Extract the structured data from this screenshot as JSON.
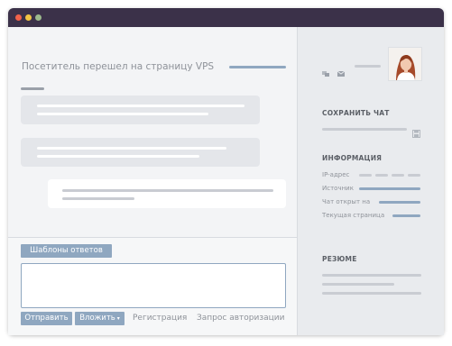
{
  "window": {
    "traffic_lights": [
      "#f0624a",
      "#f2c443",
      "#9cb98c"
    ]
  },
  "chat": {
    "visitor_event": "Посетитель перешел на страницу VPS"
  },
  "composer": {
    "templates_label": "Шаблоны ответов",
    "send_label": "Отправить",
    "attach_label": "Вложить",
    "attach_caret": "▾",
    "registration_link": "Регистрация",
    "auth_request_link": "Запрос авторизации"
  },
  "sidebar": {
    "save_chat_heading": "СОХРАНИТЬ ЧАТ",
    "info_heading": "ИНФОРМАЦИЯ",
    "info_rows": [
      {
        "label": "IP-адрес"
      },
      {
        "label": "Источник"
      },
      {
        "label": "Чат открыт на"
      },
      {
        "label": "Текущая страница"
      }
    ],
    "resume_heading": "РЕЗЮМЕ"
  },
  "colors": {
    "titlebar": "#3b3149",
    "accent": "#8fa7c0",
    "placeholder_line": "#c9ccd2"
  }
}
